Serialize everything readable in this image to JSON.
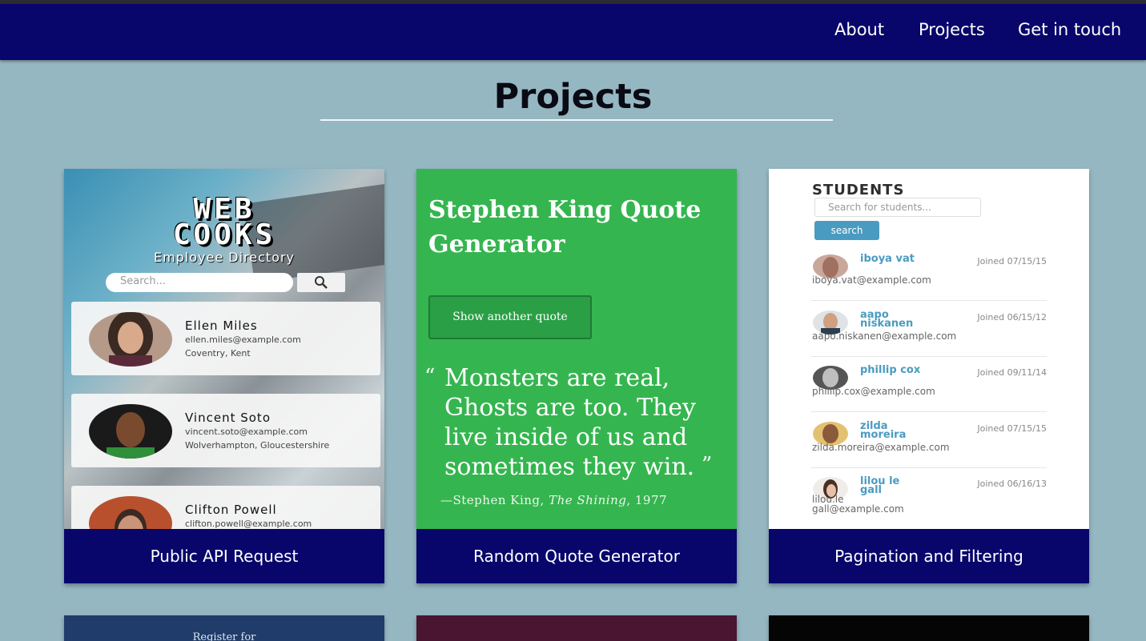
{
  "nav": {
    "about": "About",
    "projects": "Projects",
    "contact": "Get in touch"
  },
  "page": {
    "title": "Projects"
  },
  "colors": {
    "nav_bg": "#08066b",
    "page_bg": "#95b7c2",
    "quote_green": "#35b54f",
    "student_blue": "#4a9bc1"
  },
  "projects": [
    {
      "caption": "Public API Request",
      "thumb": {
        "title_line1": "WEB",
        "title_line2": "COOKS",
        "subtitle": "Employee Directory",
        "search_placeholder": "Search...",
        "search_icon": "magnifier-icon",
        "employees": [
          {
            "name": "Ellen Miles",
            "email": "ellen.miles@example.com",
            "location": "Coventry, Kent"
          },
          {
            "name": "Vincent Soto",
            "email": "vincent.soto@example.com",
            "location": "Wolverhampton, Gloucestershire"
          },
          {
            "name": "Clifton Powell",
            "email": "clifton.powell@example.com",
            "location": ""
          }
        ]
      }
    },
    {
      "caption": "Random Quote Generator",
      "thumb": {
        "title": "Stephen King Quote Generator",
        "button": "Show another quote",
        "open_quote": "“",
        "quote": "Monsters are real, Ghosts are too. They live inside of us and sometimes they win.",
        "close_quote": "”",
        "cite_author": "—Stephen King,",
        "cite_work": "The Shining",
        "cite_year": ", 1977"
      }
    },
    {
      "caption": "Pagination and Filtering",
      "thumb": {
        "title": "STUDENTS",
        "search_placeholder": "Search for students...",
        "search_button": "search",
        "students": [
          {
            "name": "iboya vat",
            "joined": "Joined 07/15/15",
            "email": "iboya.vat@example.com"
          },
          {
            "name": "aapo niskanen",
            "joined": "Joined 06/15/12",
            "email": "aapo.niskanen@example.com"
          },
          {
            "name": "phillip cox",
            "joined": "Joined 09/11/14",
            "email": "phillip.cox@example.com"
          },
          {
            "name": "zilda moreira",
            "joined": "Joined 07/15/15",
            "email": "zilda.moreira@example.com"
          },
          {
            "name": "lilou le gall",
            "joined": "Joined 06/16/13",
            "email": "lilou.le gall@example.com"
          }
        ]
      }
    }
  ],
  "partial_projects": [
    {
      "visible_text": "Register for"
    },
    {
      "visible_text": ""
    },
    {
      "visible_text": ""
    }
  ]
}
